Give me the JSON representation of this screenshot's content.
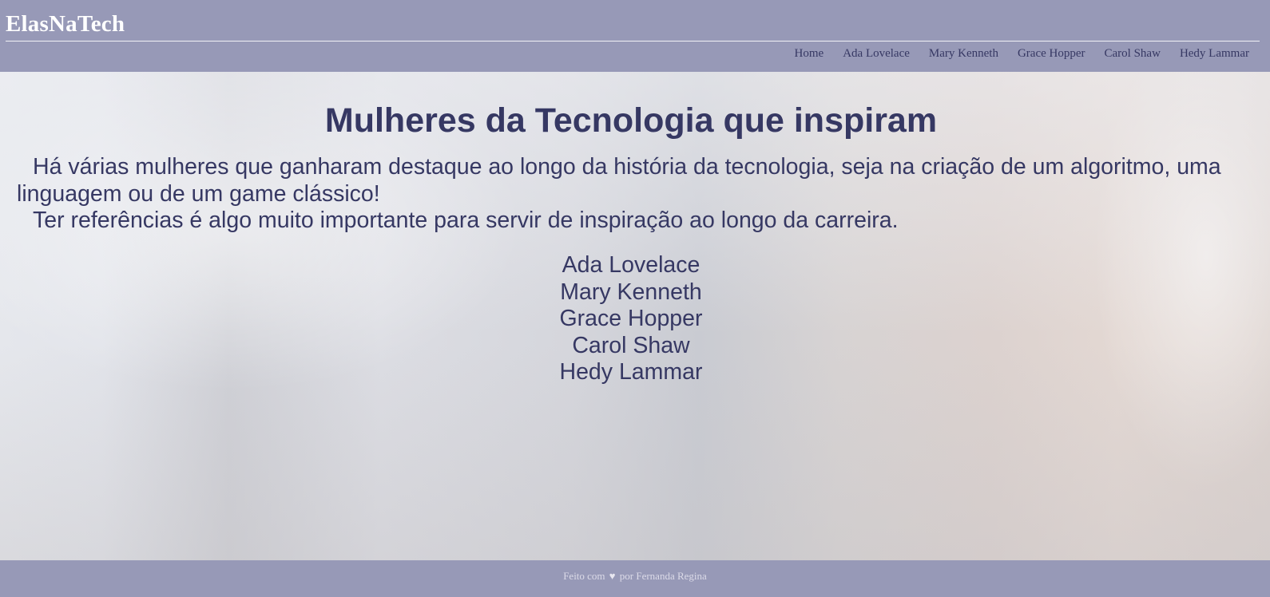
{
  "header": {
    "logo": "ElasNaTech",
    "nav": [
      {
        "label": "Home"
      },
      {
        "label": "Ada Lovelace"
      },
      {
        "label": "Mary Kenneth"
      },
      {
        "label": "Grace Hopper"
      },
      {
        "label": "Carol Shaw"
      },
      {
        "label": "Hedy Lammar"
      }
    ]
  },
  "main": {
    "title": "Mulheres da Tecnologia que inspiram",
    "paragraphs": [
      "Há várias mulheres que ganharam destaque ao longo da história da tecnologia, seja na criação de um algoritmo, uma linguagem ou de um game clássico!",
      "Ter referências é algo muito importante para servir de inspiração ao longo da carreira."
    ],
    "women": [
      "Ada Lovelace",
      "Mary Kenneth",
      "Grace Hopper",
      "Carol Shaw",
      "Hedy Lammar"
    ]
  },
  "footer": {
    "prefix": "Feito com",
    "icon": "heart-icon",
    "suffix": "por Fernanda Regina"
  },
  "colors": {
    "header_bg": "#9799b7",
    "text": "#363863",
    "logo": "#ffffff"
  }
}
